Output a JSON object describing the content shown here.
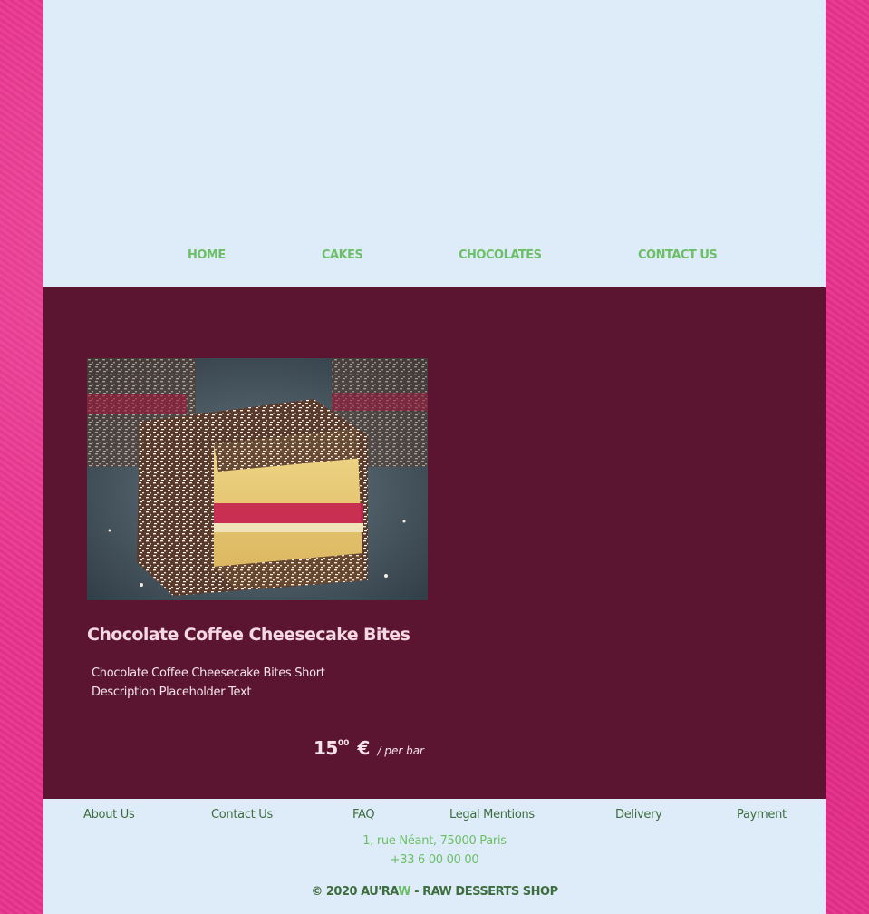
{
  "nav": {
    "items": [
      {
        "label": "HOME"
      },
      {
        "label": "CAKES"
      },
      {
        "label": "CHOCOLATES"
      },
      {
        "label": "CONTACT US"
      }
    ]
  },
  "product": {
    "title": "Chocolate Coffee Cheesecake Bites",
    "description": "Chocolate Coffee Cheesecake Bites Short Description Placeholder Text",
    "price": {
      "amount": "15",
      "cents": "00",
      "currency": "€",
      "unit": "/ per bar"
    },
    "image_alt": "coconut-raspberry-bar-image"
  },
  "footer": {
    "links": [
      {
        "label": "About Us"
      },
      {
        "label": "Contact Us"
      },
      {
        "label": "FAQ"
      },
      {
        "label": "Legal Mentions"
      },
      {
        "label": "Delivery"
      },
      {
        "label": "Payment"
      }
    ],
    "address": "1, rue Néant, 75000 Paris",
    "phone": "+33 6 00 00 00",
    "copyright_prefix": "© 2020 AU'RA",
    "copyright_w": "W",
    "copyright_suffix": " - RAW DESSERTS SHOP"
  },
  "colors": {
    "background": "#e8338d",
    "panel": "#deebf8",
    "content": "#5c1530",
    "nav_green": "#6dbf67",
    "footer_green": "#3e6e3f"
  }
}
